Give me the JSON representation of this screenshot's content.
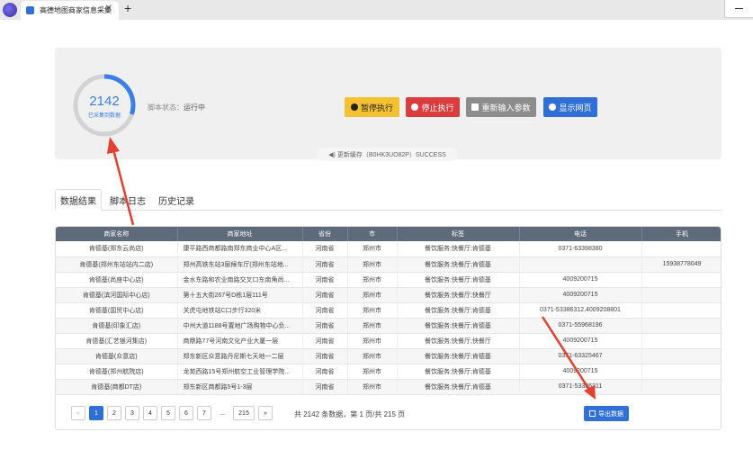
{
  "browser": {
    "tab_title": "高德地图商家信息采集",
    "close_glyph": "✕",
    "new_tab_glyph": "+"
  },
  "status": {
    "count": "2142",
    "count_label": "已采集到数据",
    "progress_fraction": 0.3,
    "script_status_label": "脚本状态：",
    "script_status_value": "运行中"
  },
  "buttons": {
    "pause": "暂停执行",
    "stop": "停止执行",
    "reinput": "重新输入参数",
    "show_web": "显示网页"
  },
  "cache_info": "◀) 更新缓存（B0HK3UO82P）SUCCESS",
  "page_tabs": [
    "数据结果",
    "脚本日志",
    "历史记录"
  ],
  "table": {
    "headers": [
      "商家名称",
      "商家地址",
      "省份",
      "市",
      "标签",
      "电话",
      "手机"
    ],
    "rows": [
      [
        "肯德基(郑东云尚店)",
        "康平路西商都路南郑东商业中心A区...",
        "河南省",
        "郑州市",
        "餐饮服务;快餐厅;肯德基",
        "0371-63398380",
        ""
      ],
      [
        "肯德基(郑州东站站内二店)",
        "郑州高铁东站3层候车厅(郑州东站地...",
        "河南省",
        "郑州市",
        "餐饮服务;快餐厅;肯德基",
        "",
        "15938778049"
      ],
      [
        "肯德基(尚座中心店)",
        "金水东路和农业南路交叉口东南角尚...",
        "河南省",
        "郑州市",
        "餐饮服务;快餐厅;肯德基",
        "4009200715",
        ""
      ],
      [
        "肯德基(滨河国际中心店)",
        "第十五大街267号D栋1层111号",
        "河南省",
        "郑州市",
        "餐饮服务;快餐厅;快餐厅",
        "4009200715",
        ""
      ],
      [
        "肯德基(国贸中心店)",
        "关虎屯地铁站C口步行320米",
        "河南省",
        "郑州市",
        "餐饮服务;快餐厅;肯德基",
        "0371-53386312,4009208801",
        ""
      ],
      [
        "肯德基(印象汇店)",
        "中州大道1188号置地广场购物中心负...",
        "河南省",
        "郑州市",
        "餐饮服务;快餐厅;肯德基",
        "0371-55968196",
        ""
      ],
      [
        "肯德基(汇艺银河集店)",
        "商鼎路77号河南文化产业大厦一层",
        "河南省",
        "郑州市",
        "餐饮服务;快餐厅;快餐厅",
        "4009200715",
        ""
      ],
      [
        "肯德基(众意店)",
        "郑东新区众意路丹尼斯七天地一二层",
        "河南省",
        "郑州市",
        "餐饮服务;快餐厅;肯德基",
        "0371-63325467",
        ""
      ],
      [
        "肯德基(郑州航院店)",
        "龙苑西路15号郑州航空工业管理学院...",
        "河南省",
        "郑州市",
        "餐饮服务;快餐厅;肯德基",
        "4009200715",
        ""
      ],
      [
        "肯德基(商都DT店)",
        "郑东新区商都路5号1-3层",
        "河南省",
        "郑州市",
        "餐饮服务;快餐厅;肯德基",
        "0371-53386311",
        ""
      ]
    ]
  },
  "pagination": {
    "prev": "«",
    "pages": [
      "1",
      "2",
      "3",
      "4",
      "5",
      "6",
      "7",
      "...",
      "215"
    ],
    "next": "»",
    "current": "1",
    "info": "共 2142 条数据，第 1 页/共 215 页"
  },
  "export_label": "导出数据",
  "colors": {
    "accent": "#2f6fd6",
    "pause": "#f5c132",
    "stop": "#db3d3f",
    "annotation_arrow": "#e2412f"
  }
}
